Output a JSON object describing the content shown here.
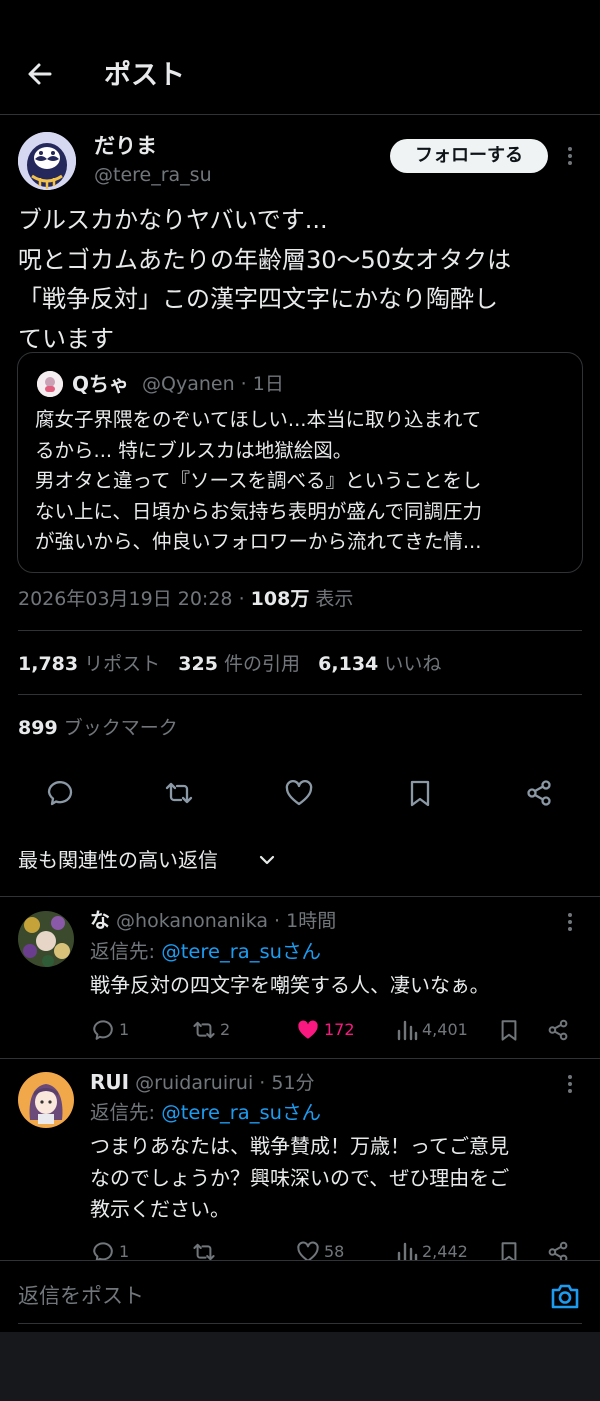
{
  "header": {
    "title": "ポスト"
  },
  "post": {
    "author_name": "だりま",
    "author_handle": "@tere_ra_su",
    "follow_label": "フォローする",
    "text_lines": [
      "ブルスカかなりヤバいです...",
      "呪とゴカムあたりの年齢層30〜50女オタクは",
      "「戦争反対」この漢字四文字にかなり陶酔し",
      "ています"
    ],
    "quote": {
      "name": "Qちゃ",
      "meta": "@Qyanen · 1日",
      "text_lines": [
        "腐女子界隈をのぞいてほしい...本当に取り込まれて",
        "るから... 特にブルスカは地獄絵図。",
        "男オタと違って『ソースを調べる』ということをし",
        "ない上に、日頃からお気持ち表明が盛んで同調圧力",
        "が強いから、仲良いフォロワーから流れてきた情..."
      ]
    },
    "timestamp": "2026年03月19日 20:28",
    "views_count": "108万",
    "views_label": "表示",
    "reposts_count": "1,783",
    "reposts_label": "リポスト",
    "quotes_count": "325",
    "quotes_label": "件の引用",
    "likes_count": "6,134",
    "likes_label": "いいね",
    "bookmarks_count": "899",
    "bookmarks_label": "ブックマーク"
  },
  "replies_filter": "最も関連性の高い返信",
  "replies": [
    {
      "name": "な",
      "meta": "@hokanonanika · 1時間",
      "reply_to_prefix": "返信先: ",
      "reply_to_handle": "@tere_ra_suさん",
      "text_lines": [
        "戦争反対の四文字を嘲笑する人、凄いなぁ。"
      ],
      "replies": "1",
      "reposts": "2",
      "likes": "172",
      "views": "4,401",
      "liked": true
    },
    {
      "name": "RUI",
      "meta": "@ruidaruirui · 51分",
      "reply_to_prefix": "返信先: ",
      "reply_to_handle": "@tere_ra_suさん",
      "text_lines": [
        "つまりあなたは、戦争賛成！万歳！ってご意見",
        "なのでしょうか？興味深いので、ぜひ理由をご",
        "教示ください。"
      ],
      "replies": "1",
      "reposts": "",
      "likes": "58",
      "views": "2,442",
      "liked": false
    }
  ],
  "composer": {
    "placeholder": "返信をポスト"
  },
  "colors": {
    "background": "#000000",
    "accent": "#1d9bf0",
    "like": "#f91880",
    "muted": "#71767b"
  }
}
